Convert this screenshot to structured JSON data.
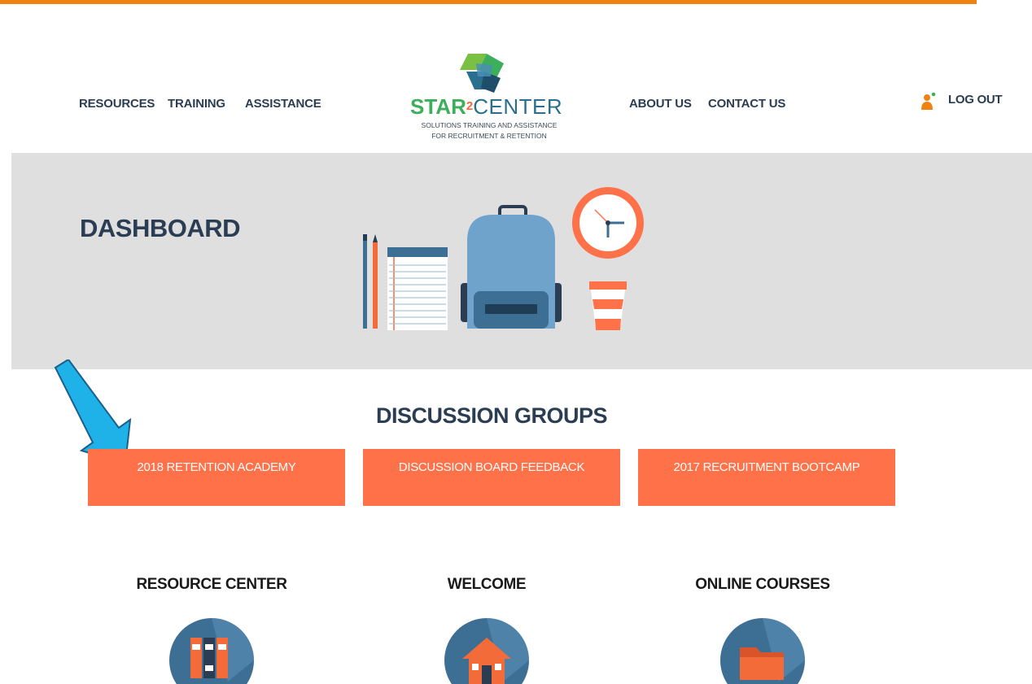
{
  "colors": {
    "accent_orange": "#f0820f",
    "button_coral": "#ff7148",
    "navy": "#2b3d52",
    "banner_gray": "#dfdfdf",
    "icon_blue": "#3d6e93",
    "arrow_blue": "#1fb2e8"
  },
  "nav": {
    "left": [
      "RESOURCES",
      "TRAINING",
      "ASSISTANCE"
    ],
    "right": [
      "ABOUT US",
      "CONTACT US"
    ],
    "logout": "LOG OUT",
    "logout_icon": "user-icon"
  },
  "logo": {
    "star": "STAR",
    "sup": "2",
    "center": "CENTER",
    "tagline_1": "SOLUTIONS TRAINING AND ASSISTANCE",
    "tagline_2": "FOR RECRUITMENT & RETENTION"
  },
  "banner": {
    "title": "DASHBOARD"
  },
  "discussion": {
    "title": "DISCUSSION GROUPS",
    "buttons": [
      "2018 RETENTION ACADEMY",
      "DISCUSSION BOARD FEEDBACK",
      "2017 RECRUITMENT BOOTCAMP"
    ]
  },
  "sections": [
    {
      "title": "RESOURCE CENTER",
      "icon": "books-icon"
    },
    {
      "title": "WELCOME",
      "icon": "house-icon"
    },
    {
      "title": "ONLINE COURSES",
      "icon": "folder-icon"
    }
  ]
}
